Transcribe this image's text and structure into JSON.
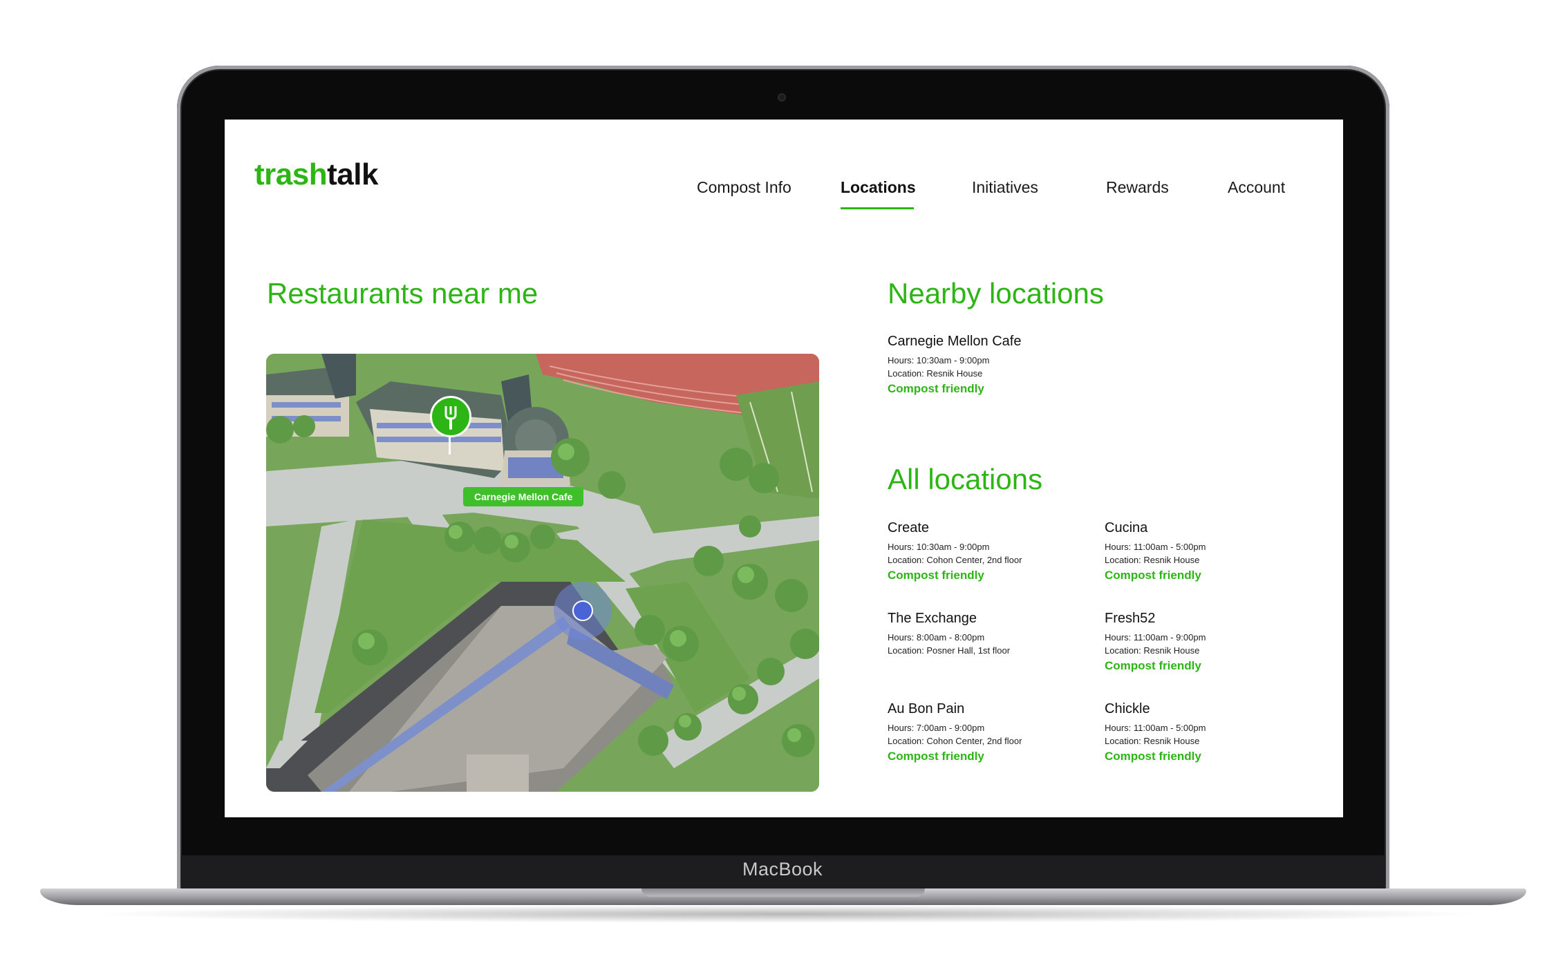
{
  "device": {
    "label": "MacBook"
  },
  "app": {
    "logo_part1": "trash",
    "logo_part2": "talk"
  },
  "nav": {
    "items": [
      {
        "label": "Compost Info",
        "active": false
      },
      {
        "label": "Locations",
        "active": true
      },
      {
        "label": "Initiatives",
        "active": false
      },
      {
        "label": "Rewards",
        "active": false
      },
      {
        "label": "Account",
        "active": false
      }
    ]
  },
  "map_section": {
    "title": "Restaurants near me",
    "pin_label": "Carnegie Mellon Cafe",
    "pin_icon": "fork-icon"
  },
  "nearby": {
    "title": "Nearby locations",
    "items": [
      {
        "name": "Carnegie Mellon Cafe",
        "hours": "Hours: 10:30am - 9:00pm",
        "location": "Location: Resnik House",
        "tag": "Compost friendly"
      }
    ]
  },
  "all": {
    "title": "All locations",
    "items": [
      {
        "name": "Create",
        "hours": "Hours: 10:30am - 9:00pm",
        "location": "Location: Cohon Center, 2nd floor",
        "tag": "Compost friendly"
      },
      {
        "name": "Cucina",
        "hours": "Hours: 11:00am - 5:00pm",
        "location": "Location: Resnik House",
        "tag": "Compost friendly"
      },
      {
        "name": "The Exchange",
        "hours": "Hours: 8:00am - 8:00pm",
        "location": "Location: Posner Hall, 1st floor",
        "tag": ""
      },
      {
        "name": "Fresh52",
        "hours": "Hours: 11:00am - 9:00pm",
        "location": "Location: Resnik House",
        "tag": "Compost friendly"
      },
      {
        "name": "Au Bon Pain",
        "hours": "Hours: 7:00am - 9:00pm",
        "location": "Location: Cohon Center, 2nd floor",
        "tag": "Compost friendly"
      },
      {
        "name": "Chickle",
        "hours": "Hours: 11:00am - 5:00pm",
        "location": "Location: Resnik House",
        "tag": "Compost friendly"
      }
    ]
  },
  "colors": {
    "accent": "#2db516",
    "text": "#111111",
    "user_dot": "#4a63d6"
  }
}
